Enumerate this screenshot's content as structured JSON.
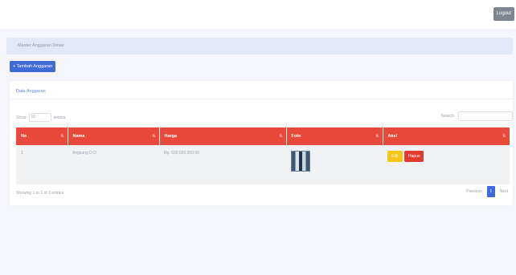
{
  "header": {
    "logout_label": "Logout"
  },
  "breadcrumb": {
    "text": "Master Anggaran Dinas"
  },
  "toolbar": {
    "add_label": "+ Tambah Anggaran"
  },
  "card": {
    "title": "Data Anggaran",
    "show_label": "Show",
    "entries_value": "10",
    "entries_label": "entries",
    "search_label": "Search:",
    "search_value": "",
    "search_placeholder": ""
  },
  "table": {
    "columns": [
      "No",
      "Nama",
      "Harga",
      "Foto",
      "Aksi"
    ],
    "rows": [
      {
        "no": "1",
        "nama": "Angsung D.O",
        "harga": "Rp. 500.000.000,00",
        "foto": "image-thumbnail"
      }
    ],
    "edit_label": "Edit",
    "delete_label": "Hapus"
  },
  "footer": {
    "info": "Showing 1 to 1 of 1 entries",
    "previous_label": "Previous",
    "current_page": "1",
    "next_label": "Next"
  },
  "colors": {
    "header_red": "#e8493a",
    "primary_blue": "#3f6ad8",
    "edit_yellow": "#f5c518",
    "delete_red": "#e23b2e"
  }
}
